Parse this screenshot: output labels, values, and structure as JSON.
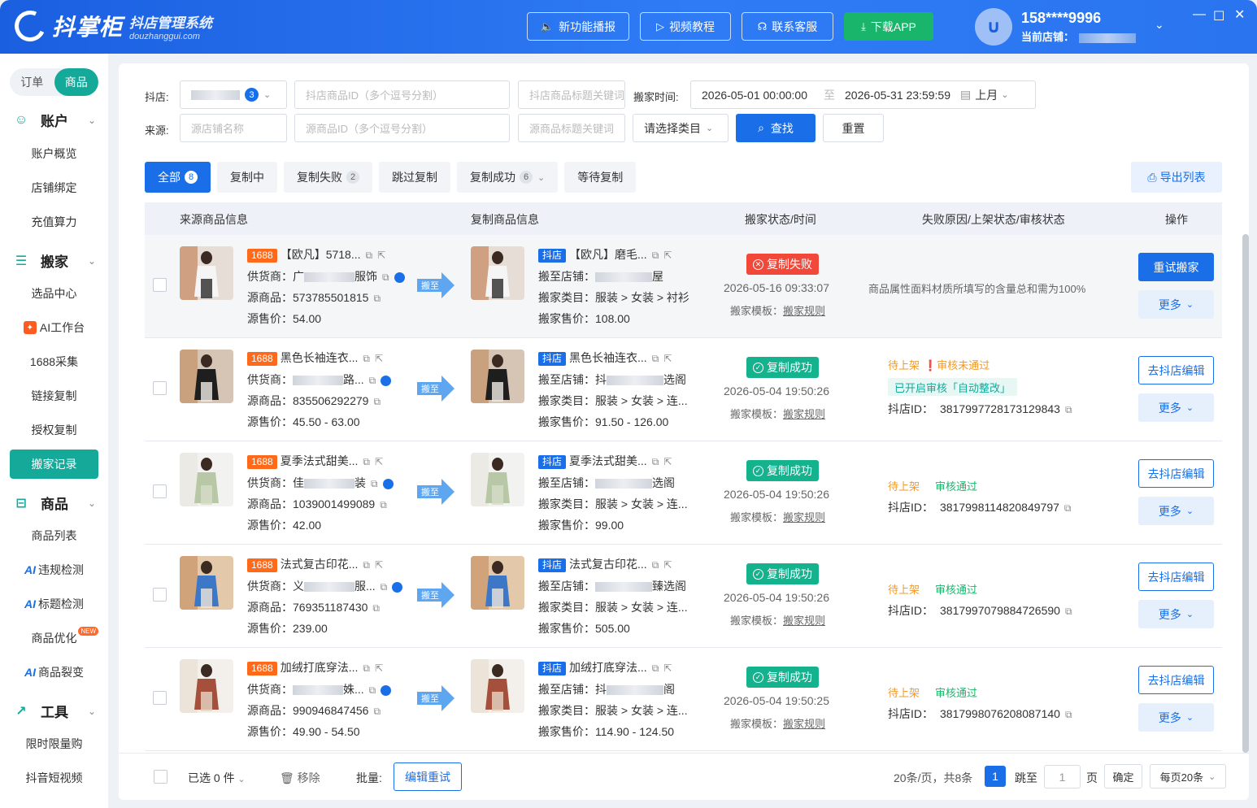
{
  "header": {
    "logo_name": "抖掌柜",
    "logo_sub": "抖店管理系统",
    "logo_url": "douzhanggui.com",
    "btn_feature": "新功能播报",
    "btn_video": "视频教程",
    "btn_service": "联系客服",
    "btn_download": "下载APP",
    "user_phone": "158****9996",
    "user_store_label": "当前店铺："
  },
  "sidebar": {
    "seg_orders": "订单",
    "seg_products": "商品",
    "groups": [
      "账户",
      "搬家",
      "商品",
      "工具"
    ],
    "items": [
      "账户概览",
      "店铺绑定",
      "充值算力",
      "选品中心",
      "AI工作台",
      "1688采集",
      "链接复制",
      "授权复制",
      "搬家记录",
      "商品列表",
      "违规检测",
      "标题检测",
      "商品优化",
      "商品裂变",
      "限时限量购",
      "抖音短视频"
    ],
    "ai_tag": "AI",
    "new_tag": "NEW"
  },
  "filters": {
    "shop_label": "抖店:",
    "shop_count": "3",
    "ph_shop_pid": "抖店商品ID（多个逗号分割）",
    "ph_shop_title": "抖店商品标题关键词",
    "time_label": "搬家时间:",
    "time_start": "2026-05-01 00:00:00",
    "time_to": "至",
    "time_end": "2026-05-31 23:59:59",
    "time_quick": "上月",
    "source_label": "来源:",
    "ph_src_shop": "源店铺名称",
    "ph_src_pid": "源商品ID（多个逗号分割）",
    "ph_src_title": "源商品标题关键词",
    "ph_category": "请选择类目",
    "search": "查找",
    "reset": "重置"
  },
  "tabs": [
    {
      "label": "全部",
      "count": "8"
    },
    {
      "label": "复制中",
      "count": ""
    },
    {
      "label": "复制失败",
      "count": "2"
    },
    {
      "label": "跳过复制",
      "count": ""
    },
    {
      "label": "复制成功",
      "count": "6"
    },
    {
      "label": "等待复制",
      "count": ""
    }
  ],
  "export_label": "导出列表",
  "table_headers": [
    "来源商品信息",
    "复制商品信息",
    "搬家状态/时间",
    "失败原因/上架状态/审核状态",
    "操作"
  ],
  "labels": {
    "tag_1688": "1688",
    "tag_dy": "抖店",
    "supplier": "供货商：",
    "src_id": "源商品：",
    "src_price": "源售价：",
    "dest_shop": "搬至店铺：",
    "dest_cat": "搬家类目：",
    "dest_price": "搬家售价：",
    "template": "搬家模板：",
    "template_link": "搬家规则",
    "arrow": "搬至",
    "dy_id": "抖店ID：",
    "more": "更多"
  },
  "rows": [
    {
      "src_title": "【欧凡】5718...",
      "supplier_pre": "广",
      "supplier_suf": "服饰",
      "src_id": "573785501815",
      "src_price": "54.00",
      "dest_title": "【欧凡】磨毛...",
      "dest_shop_pre": "",
      "dest_shop_suf": "屋",
      "dest_cat": "服装 > 女装 > 衬衫",
      "dest_price": "108.00",
      "status": "复制失败",
      "status_type": "fail",
      "time": "2026-05-16 09:33:07",
      "reason": "商品属性面料材质所填写的含量总和需为100%",
      "listing": "",
      "audit": "",
      "auto": "",
      "dy_id": "",
      "op": "重试搬家"
    },
    {
      "src_title": "黑色长袖连衣...",
      "supplier_pre": "",
      "supplier_suf": "路...",
      "src_id": "835506292279",
      "src_price": "45.50 - 63.00",
      "dest_title": "黑色长袖连衣...",
      "dest_shop_pre": "抖",
      "dest_shop_suf": "选阁",
      "dest_cat": "服装 > 女装 > 连...",
      "dest_price": "91.50 - 126.00",
      "status": "复制成功",
      "status_type": "ok",
      "time": "2026-05-04 19:50:26",
      "reason": "",
      "listing": "待上架",
      "audit": "审核未通过",
      "auto": "已开启审核「自动整改」",
      "dy_id": "3817997728173129843",
      "op": "去抖店编辑"
    },
    {
      "src_title": "夏季法式甜美...",
      "supplier_pre": "佳",
      "supplier_suf": "装",
      "src_id": "1039001499089",
      "src_price": "42.00",
      "dest_title": "夏季法式甜美...",
      "dest_shop_pre": "",
      "dest_shop_suf": "选阁",
      "dest_cat": "服装 > 女装 > 连...",
      "dest_price": "99.00",
      "status": "复制成功",
      "status_type": "ok",
      "time": "2026-05-04 19:50:26",
      "reason": "",
      "listing": "待上架",
      "audit": "审核通过",
      "auto": "",
      "dy_id": "3817998114820849797",
      "op": "去抖店编辑"
    },
    {
      "src_title": "法式复古印花...",
      "supplier_pre": "义",
      "supplier_suf": "服...",
      "src_id": "769351187430",
      "src_price": "239.00",
      "dest_title": "法式复古印花...",
      "dest_shop_pre": "",
      "dest_shop_suf": "臻选阁",
      "dest_cat": "服装 > 女装 > 连...",
      "dest_price": "505.00",
      "status": "复制成功",
      "status_type": "ok",
      "time": "2026-05-04 19:50:26",
      "reason": "",
      "listing": "待上架",
      "audit": "审核通过",
      "auto": "",
      "dy_id": "3817997079884726590",
      "op": "去抖店编辑"
    },
    {
      "src_title": "加绒打底穿法...",
      "supplier_pre": "",
      "supplier_suf": "姝...",
      "src_id": "990946847456",
      "src_price": "49.90 - 54.50",
      "dest_title": "加绒打底穿法...",
      "dest_shop_pre": "抖",
      "dest_shop_suf": "阁",
      "dest_cat": "服装 > 女装 > 连...",
      "dest_price": "114.90 - 124.50",
      "status": "复制成功",
      "status_type": "ok",
      "time": "2026-05-04 19:50:25",
      "reason": "",
      "listing": "待上架",
      "audit": "审核通过",
      "auto": "",
      "dy_id": "3817998076208087140",
      "op": "去抖店编辑"
    }
  ],
  "footer": {
    "selected": "已选 0 件",
    "remove": "移除",
    "batch": "批量:",
    "edit_retry": "编辑重试",
    "summary": "20条/页，共8条",
    "page": "1",
    "jump": "跳至",
    "page_unit": "页",
    "page_input": "1",
    "confirm": "确定",
    "per_page": "每页20条"
  },
  "colors": {
    "brand": "#1a6fe8",
    "teal": "#15a99a",
    "fail": "#f2483a",
    "ok": "#15b28e",
    "orange": "#ff6a1a"
  }
}
